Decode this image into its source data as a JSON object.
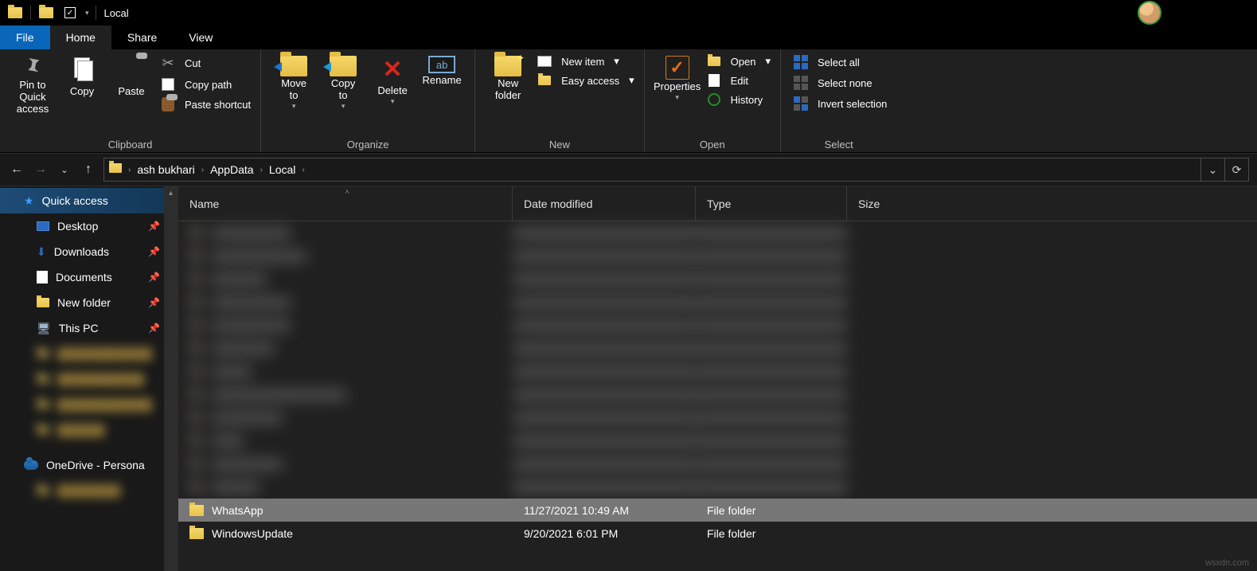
{
  "title": "Local",
  "tabs": {
    "file": "File",
    "home": "Home",
    "share": "Share",
    "view": "View"
  },
  "ribbon": {
    "clipboard": {
      "label": "Clipboard",
      "pin": "Pin to Quick\naccess",
      "copy": "Copy",
      "paste": "Paste",
      "cut": "Cut",
      "copypath": "Copy path",
      "pasteshortcut": "Paste shortcut"
    },
    "organize": {
      "label": "Organize",
      "moveto": "Move\nto",
      "copyto": "Copy\nto",
      "delete": "Delete",
      "rename": "Rename"
    },
    "new": {
      "label": "New",
      "newfolder": "New\nfolder",
      "newitem": "New item",
      "easyaccess": "Easy access"
    },
    "open": {
      "label": "Open",
      "properties": "Properties",
      "open": "Open",
      "edit": "Edit",
      "history": "History"
    },
    "select": {
      "label": "Select",
      "all": "Select all",
      "none": "Select none",
      "invert": "Invert selection"
    }
  },
  "breadcrumb": [
    "ash bukhari",
    "AppData",
    "Local"
  ],
  "sidebar": {
    "quickaccess": "Quick access",
    "desktop": "Desktop",
    "downloads": "Downloads",
    "documents": "Documents",
    "newfolder": "New folder",
    "thispc": "This PC",
    "onedrive": "OneDrive - Persona"
  },
  "columns": {
    "name": "Name",
    "date": "Date modified",
    "type": "Type",
    "size": "Size"
  },
  "rows": [
    {
      "name": "WhatsApp",
      "date": "11/27/2021 10:49 AM",
      "type": "File folder",
      "size": "",
      "selected": true
    },
    {
      "name": "WindowsUpdate",
      "date": "9/20/2021 6:01 PM",
      "type": "File folder",
      "size": "",
      "selected": false
    }
  ],
  "watermark": "wsxdn.com"
}
